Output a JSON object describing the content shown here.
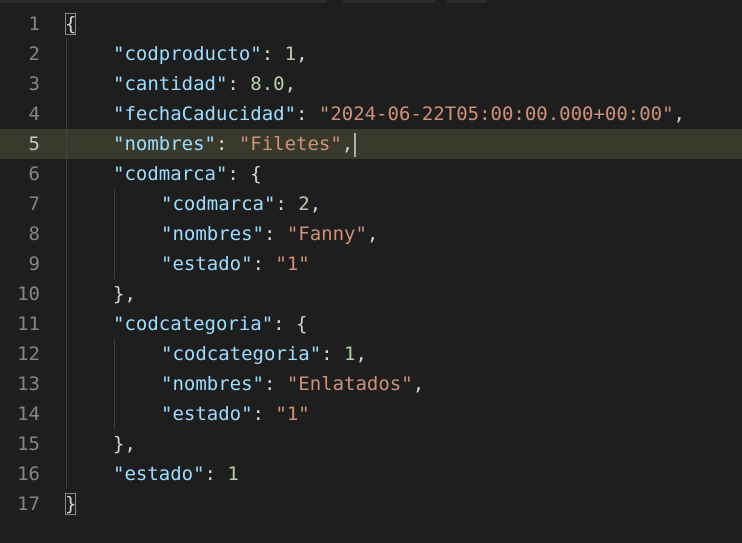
{
  "editor": {
    "language": "json",
    "current_line": 5,
    "colors": {
      "background": "#1e1e1e",
      "key": "#9cdcfe",
      "string": "#ce9178",
      "number": "#b5cea8",
      "punctuation": "#d4d4d4",
      "line_number": "#858585",
      "current_line_highlight": "#3a3a2c"
    },
    "lines": [
      {
        "number": "1",
        "indent": 0,
        "tokens": [
          {
            "t": "brace",
            "v": "{",
            "match": true
          }
        ]
      },
      {
        "number": "2",
        "indent": 1,
        "tokens": [
          {
            "t": "key",
            "v": "\"codproducto\""
          },
          {
            "t": "punc",
            "v": ": "
          },
          {
            "t": "num",
            "v": "1"
          },
          {
            "t": "punc",
            "v": ","
          }
        ]
      },
      {
        "number": "3",
        "indent": 1,
        "tokens": [
          {
            "t": "key",
            "v": "\"cantidad\""
          },
          {
            "t": "punc",
            "v": ": "
          },
          {
            "t": "num",
            "v": "8.0"
          },
          {
            "t": "punc",
            "v": ","
          }
        ]
      },
      {
        "number": "4",
        "indent": 1,
        "tokens": [
          {
            "t": "key",
            "v": "\"fechaCaducidad\""
          },
          {
            "t": "punc",
            "v": ": "
          },
          {
            "t": "str",
            "v": "\"2024-06-22T05:00:00.000+00:00\""
          },
          {
            "t": "punc",
            "v": ","
          }
        ]
      },
      {
        "number": "5",
        "indent": 1,
        "caret": true,
        "tokens": [
          {
            "t": "key",
            "v": "\"nombres\""
          },
          {
            "t": "punc",
            "v": ": "
          },
          {
            "t": "str",
            "v": "\"Filetes\""
          },
          {
            "t": "punc",
            "v": ","
          }
        ]
      },
      {
        "number": "6",
        "indent": 1,
        "tokens": [
          {
            "t": "key",
            "v": "\"codmarca\""
          },
          {
            "t": "punc",
            "v": ": "
          },
          {
            "t": "brace",
            "v": "{"
          }
        ]
      },
      {
        "number": "7",
        "indent": 2,
        "tokens": [
          {
            "t": "key",
            "v": "\"codmarca\""
          },
          {
            "t": "punc",
            "v": ": "
          },
          {
            "t": "num",
            "v": "2"
          },
          {
            "t": "punc",
            "v": ","
          }
        ]
      },
      {
        "number": "8",
        "indent": 2,
        "tokens": [
          {
            "t": "key",
            "v": "\"nombres\""
          },
          {
            "t": "punc",
            "v": ": "
          },
          {
            "t": "str",
            "v": "\"Fanny\""
          },
          {
            "t": "punc",
            "v": ","
          }
        ]
      },
      {
        "number": "9",
        "indent": 2,
        "tokens": [
          {
            "t": "key",
            "v": "\"estado\""
          },
          {
            "t": "punc",
            "v": ": "
          },
          {
            "t": "str",
            "v": "\"1\""
          }
        ]
      },
      {
        "number": "10",
        "indent": 1,
        "tokens": [
          {
            "t": "brace",
            "v": "}"
          },
          {
            "t": "punc",
            "v": ","
          }
        ]
      },
      {
        "number": "11",
        "indent": 1,
        "tokens": [
          {
            "t": "key",
            "v": "\"codcategoria\""
          },
          {
            "t": "punc",
            "v": ": "
          },
          {
            "t": "brace",
            "v": "{"
          }
        ]
      },
      {
        "number": "12",
        "indent": 2,
        "tokens": [
          {
            "t": "key",
            "v": "\"codcategoria\""
          },
          {
            "t": "punc",
            "v": ": "
          },
          {
            "t": "num",
            "v": "1"
          },
          {
            "t": "punc",
            "v": ","
          }
        ]
      },
      {
        "number": "13",
        "indent": 2,
        "tokens": [
          {
            "t": "key",
            "v": "\"nombres\""
          },
          {
            "t": "punc",
            "v": ": "
          },
          {
            "t": "str",
            "v": "\"Enlatados\""
          },
          {
            "t": "punc",
            "v": ","
          }
        ]
      },
      {
        "number": "14",
        "indent": 2,
        "tokens": [
          {
            "t": "key",
            "v": "\"estado\""
          },
          {
            "t": "punc",
            "v": ": "
          },
          {
            "t": "str",
            "v": "\"1\""
          }
        ]
      },
      {
        "number": "15",
        "indent": 1,
        "tokens": [
          {
            "t": "brace",
            "v": "}"
          },
          {
            "t": "punc",
            "v": ","
          }
        ]
      },
      {
        "number": "16",
        "indent": 1,
        "tokens": [
          {
            "t": "key",
            "v": "\"estado\""
          },
          {
            "t": "punc",
            "v": ": "
          },
          {
            "t": "num",
            "v": "1"
          }
        ]
      },
      {
        "number": "17",
        "indent": 0,
        "tokens": [
          {
            "t": "brace",
            "v": "}",
            "match": true
          }
        ]
      }
    ]
  }
}
